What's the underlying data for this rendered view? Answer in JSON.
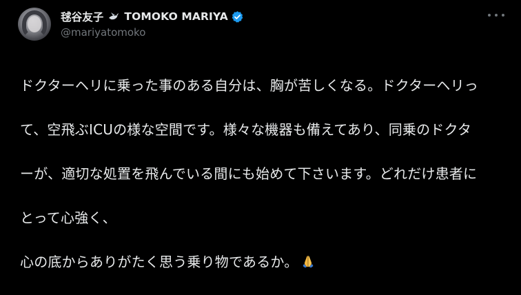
{
  "user": {
    "display_name": "毬谷友子",
    "display_name_latin": "TOMOKO MARIYA",
    "handle": "@mariyatomoko",
    "name_emoji_icon": "dove-icon",
    "verified_icon": "verified-badge-icon"
  },
  "tweet": {
    "lines": [
      "ドクターヘリに乗った事のある自分は、胸が苦しくなる。ドクターヘリっ",
      "て、空飛ぶICUの様な空間です。様々な機器も備えてあり、同乗のドクタ",
      "ーが、適切な処置を飛んでいる間にも始めて下さいます。どれだけ患者に",
      "とって心強く、",
      "心の底からありがたく思う乗り物であるか。"
    ],
    "trailing_emoji_icon": "folded-hands-icon"
  },
  "menu": {
    "more_icon": "more-options-icon"
  },
  "colors": {
    "background": "#000000",
    "text_primary": "#e7e9ea",
    "text_secondary": "#71767b",
    "verified_blue": "#1d9bf0"
  }
}
